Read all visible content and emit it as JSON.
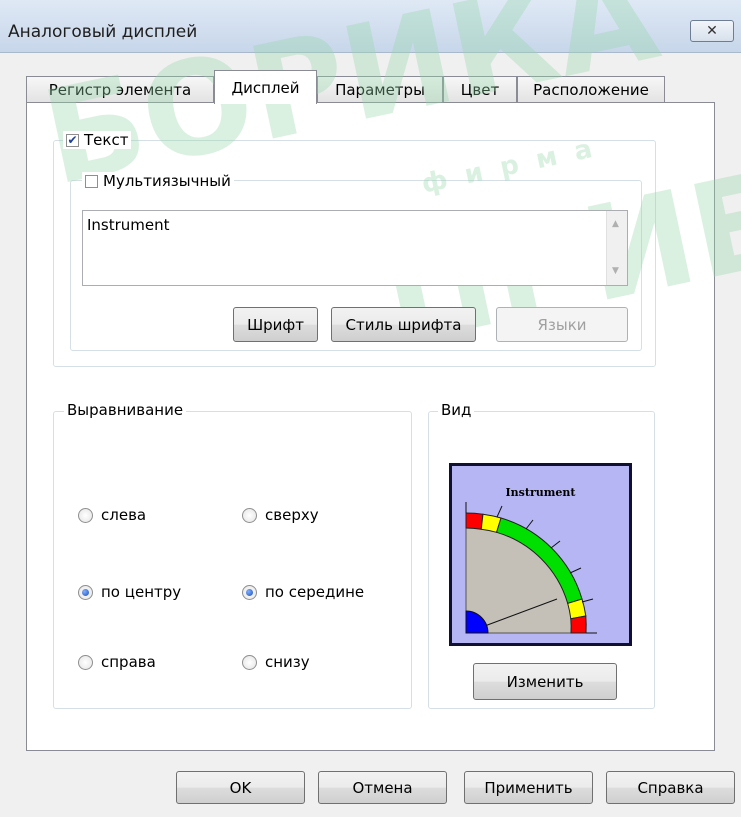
{
  "window": {
    "title": "Аналоговый дисплей",
    "close_symbol": "✕"
  },
  "tabs": [
    {
      "label": "Регистр элемента"
    },
    {
      "label": "Дисплей"
    },
    {
      "label": "Параметры"
    },
    {
      "label": "Цвет"
    },
    {
      "label": "Расположение"
    }
  ],
  "active_tab": "Дисплей",
  "text_group": {
    "checkbox_label": "Текст",
    "checked": true,
    "multilang_label": "Мультиязычный",
    "multilang_checked": false,
    "text_value": "Instrument",
    "buttons": {
      "font": "Шрифт",
      "font_style": "Стиль шрифта",
      "languages": "Языки"
    }
  },
  "alignment": {
    "title": "Выравнивание",
    "options": {
      "left": "слева",
      "top": "сверху",
      "center": "по центру",
      "middle": "по середине",
      "right": "справа",
      "bottom": "снизу"
    },
    "selected_horizontal": "по центру",
    "selected_vertical": "по середине"
  },
  "view": {
    "title": "Вид",
    "preview_title": "Instrument",
    "change_button": "Изменить",
    "colors": {
      "background": "#b6b6f4",
      "dial": "#c4c0b8",
      "red": "#ff0000",
      "yellow": "#ffff00",
      "green": "#00e000",
      "blue": "#0000ff"
    }
  },
  "footer": {
    "ok": "OK",
    "cancel": "Отмена",
    "apply": "Применить",
    "help": "Справка"
  },
  "watermark": {
    "main": "БОРИКА",
    "sub": "фирма",
    "brand": "ПРИБОР"
  }
}
